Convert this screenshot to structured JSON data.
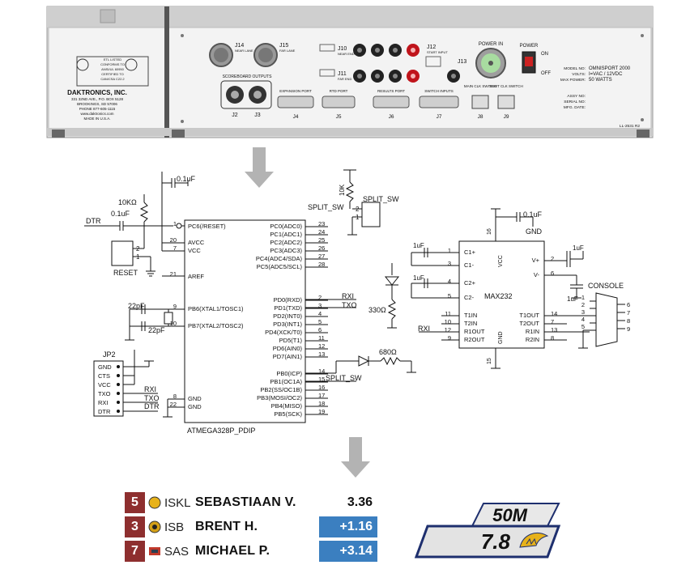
{
  "panel": {
    "manufacturer_block": [
      "DAKTRONICS, INC.",
      "331 32ND AVE., P.O. BOX 5128",
      "BROOKINGS, SD 57006",
      "PHONE 877-605-1115",
      "www.daktronics.com",
      "MADE IN U.S.A."
    ],
    "cert_text": [
      "ETL LISTED",
      "CONFORMS TO",
      "ANSI/UL 60950",
      "CERTIFIED TO",
      "CAN/CSA C22.2"
    ],
    "j14": {
      "id": "J14",
      "sub": "NEAR LANE"
    },
    "j15": {
      "id": "J15",
      "sub": "FAR LANE"
    },
    "scoreboard_outputs": "SCOREBOARD OUTPUTS",
    "j2": "J2",
    "j3": "J3",
    "ports": [
      {
        "label": "EXPANSION PORT",
        "id": "J4"
      },
      {
        "label": "RTD PORT",
        "id": "J5"
      },
      {
        "label": "RESULTS PORT",
        "id": "J6"
      },
      {
        "label": "SWITCH INPUTS",
        "id": "J7"
      }
    ],
    "j10": {
      "id": "J10",
      "sub": "NEAR END"
    },
    "j11": {
      "id": "J11",
      "sub": "FAR END"
    },
    "j12": {
      "id": "J12",
      "sub": "START INPUT"
    },
    "j13": "J13",
    "power_in": "POWER IN",
    "power": "POWER",
    "on": "ON",
    "off": "OFF",
    "main_clk": {
      "label": "MAIN CLK SWITCH",
      "id": "J8"
    },
    "shot_clk": {
      "label": "SHOT CLK SWITCH",
      "id": "J9"
    },
    "model_labels": [
      "MODEL NO:",
      "VOLTS:",
      "MAX POWER:"
    ],
    "model_values": [
      "OMNISPORT 2000",
      "I=VAC / 12VDC",
      "50 WATTS"
    ],
    "assy_labels": [
      "ASSY NO:",
      "SERIAL NO:",
      "MFG. DATE:"
    ],
    "part_no": "LL-2531 R2"
  },
  "schematic": {
    "mcu_name": "ATMEGA328P_PDIP",
    "left_pins": [
      {
        "num": "1",
        "name": "PC6(/RESET)"
      },
      {
        "num": "20",
        "name": "AVCC"
      },
      {
        "num": "7",
        "name": "VCC"
      },
      {
        "num": "21",
        "name": "AREF"
      },
      {
        "num": "9",
        "name": "PB6(XTAL1/TOSC1)"
      },
      {
        "num": "10",
        "name": "PB7(XTAL2/TOSC2)"
      },
      {
        "num": "8",
        "name": "GND"
      },
      {
        "num": "22",
        "name": "GND"
      }
    ],
    "right_pins": [
      {
        "num": "23",
        "name": "PC0(ADC0)"
      },
      {
        "num": "24",
        "name": "PC1(ADC1)"
      },
      {
        "num": "25",
        "name": "PC2(ADC2)"
      },
      {
        "num": "26",
        "name": "PC3(ADC3)"
      },
      {
        "num": "27",
        "name": "PC4(ADC4/SDA)"
      },
      {
        "num": "28",
        "name": "PC5(ADC5/SCL)"
      },
      {
        "num": "2",
        "name": "PD0(RXD)"
      },
      {
        "num": "3",
        "name": "PD1(TXD)"
      },
      {
        "num": "4",
        "name": "PD2(INT0)"
      },
      {
        "num": "5",
        "name": "PD3(INT1)"
      },
      {
        "num": "6",
        "name": "PD4(XCK/T0)"
      },
      {
        "num": "11",
        "name": "PD5(T1)"
      },
      {
        "num": "12",
        "name": "PD6(AIN0)"
      },
      {
        "num": "13",
        "name": "PD7(AIN1)"
      },
      {
        "num": "14",
        "name": "PB0(ICP)"
      },
      {
        "num": "15",
        "name": "PB1(OC1A)"
      },
      {
        "num": "16",
        "name": "PB2(SS/OC1B)"
      },
      {
        "num": "17",
        "name": "PB3(MOSI/OC2)"
      },
      {
        "num": "18",
        "name": "PB4(MISO)"
      },
      {
        "num": "19",
        "name": "PB5(SCK)"
      }
    ],
    "cap_top": "0.1uF",
    "res_10k": "10KΩ",
    "cap_reset": "0.1uF",
    "dtr": "DTR",
    "reset": "RESET",
    "reset_pins": [
      "2",
      "1"
    ],
    "xtal_c1": "22pF",
    "xtal_c2": "22pF",
    "rxi": "RXI",
    "txo": "TXO",
    "res_330": "330Ω",
    "res_680": "680Ω",
    "split_sw": "SPLIT_SW",
    "split_sw_header": "SPLIT_SW",
    "split_sw_net": "SPLIT_SW",
    "split_sw_pb1": "SPLIT_SW",
    "res_10k_sw": "10K",
    "sw_pins": [
      "2",
      "1"
    ],
    "jp2_name": "JP2",
    "jp2_pins": [
      "GND",
      "CTS",
      "VCC",
      "TXO",
      "RXI",
      "DTR"
    ],
    "jp2_nets": [
      "RXI",
      "TXO",
      "DTR"
    ],
    "max232": {
      "name": "MAX232",
      "left": [
        {
          "num": "1",
          "name": "C1+"
        },
        {
          "num": "3",
          "name": "C1-"
        },
        {
          "num": "4",
          "name": "C2+"
        },
        {
          "num": "5",
          "name": "C2-"
        },
        {
          "num": "11",
          "name": "T1IN"
        },
        {
          "num": "10",
          "name": "T2IN"
        },
        {
          "num": "12",
          "name": "R1OUT"
        },
        {
          "num": "9",
          "name": "R2OUT"
        }
      ],
      "right": [
        {
          "num": "2",
          "name": "V+"
        },
        {
          "num": "6",
          "name": "V-"
        },
        {
          "num": "14",
          "name": "T1OUT"
        },
        {
          "num": "7",
          "name": "T2OUT"
        },
        {
          "num": "13",
          "name": "R1IN"
        },
        {
          "num": "8",
          "name": "R2IN"
        }
      ],
      "vcc": "VCC",
      "gnd": "GND",
      "vcc_pin": "16",
      "gnd_pin": "15"
    },
    "max_cap_top": "0.1uF",
    "max_gnd": "GND",
    "cap_1uf": [
      "1uF",
      "1uF",
      "1uF",
      "1uF"
    ],
    "max_rxi": "RXI",
    "console": "CONSOLE",
    "db9_pins": [
      "1",
      "2",
      "3",
      "4",
      "5",
      "6",
      "7",
      "8",
      "9"
    ]
  },
  "scoreboard": {
    "rows": [
      {
        "pos": "5",
        "team": "ISKL",
        "name": "SEBASTIAAN V.",
        "time": "3.36",
        "is_gap": false,
        "logo_color": "#e7b21a"
      },
      {
        "pos": "3",
        "team": "ISB",
        "name": "BRENT H.",
        "time": "+1.16",
        "is_gap": true,
        "logo_color": "#d4a017"
      },
      {
        "pos": "7",
        "team": "SAS",
        "name": "MICHAEL P.",
        "time": "+3.14",
        "is_gap": true,
        "logo_color": "#c0392b"
      }
    ],
    "colors": {
      "pos_bg": "#8e2f2f",
      "gap_bg": "#3b7fc0"
    }
  },
  "timer": {
    "event": "50M",
    "time": "7.8",
    "accent": "#e7b21a",
    "border": "#1e2f6e"
  }
}
